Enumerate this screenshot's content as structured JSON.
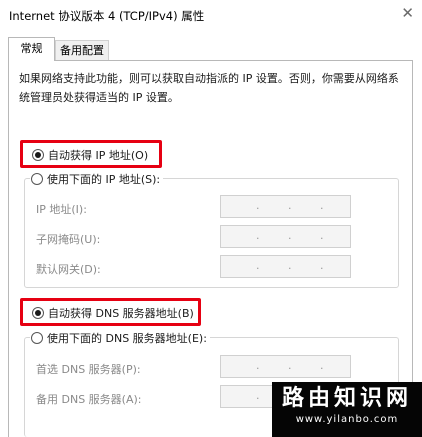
{
  "window": {
    "title": "Internet 协议版本 4 (TCP/IPv4) 属性",
    "close_glyph": "✕"
  },
  "tabs": [
    {
      "label": "常规"
    },
    {
      "label": "备用配置"
    }
  ],
  "description": "如果网络支持此功能，则可以获取自动指派的 IP 设置。否则，你需要从网络系统管理员处获得适当的 IP 设置。",
  "ip_section": {
    "auto_label": "自动获得 IP 地址(O)",
    "auto_selected": true,
    "manual_label": "使用下面的 IP 地址(S):",
    "manual_selected": false,
    "fields": [
      {
        "label": "IP 地址(I):"
      },
      {
        "label": "子网掩码(U):"
      },
      {
        "label": "默认网关(D):"
      }
    ]
  },
  "dns_section": {
    "auto_label": "自动获得 DNS 服务器地址(B)",
    "auto_selected": true,
    "manual_label": "使用下面的 DNS 服务器地址(E):",
    "manual_selected": false,
    "fields": [
      {
        "label": "首选 DNS 服务器(P):"
      },
      {
        "label": "备用 DNS 服务器(A):"
      }
    ]
  },
  "ip_separator": ".",
  "watermark": {
    "brand": "路由知识网",
    "url": "www.yilanbo.com"
  },
  "colors": {
    "highlight": "#e60012",
    "disabled_text": "#8a8a8a",
    "watermark_bg": "#050505"
  }
}
